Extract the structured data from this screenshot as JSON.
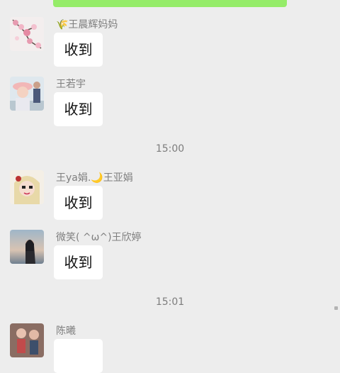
{
  "messages": [
    {
      "sender": "🌾王晨辉妈妈",
      "text": "收到"
    },
    {
      "sender": "王若宇",
      "text": "收到"
    },
    {
      "sender": "王ya娟.🌙王亚娟",
      "text": "收到"
    },
    {
      "sender": "微笑( ^ω^)王欣婷",
      "text": "收到"
    },
    {
      "sender": "陈曦"
    }
  ],
  "timestamps": [
    "15:00",
    "15:01"
  ]
}
